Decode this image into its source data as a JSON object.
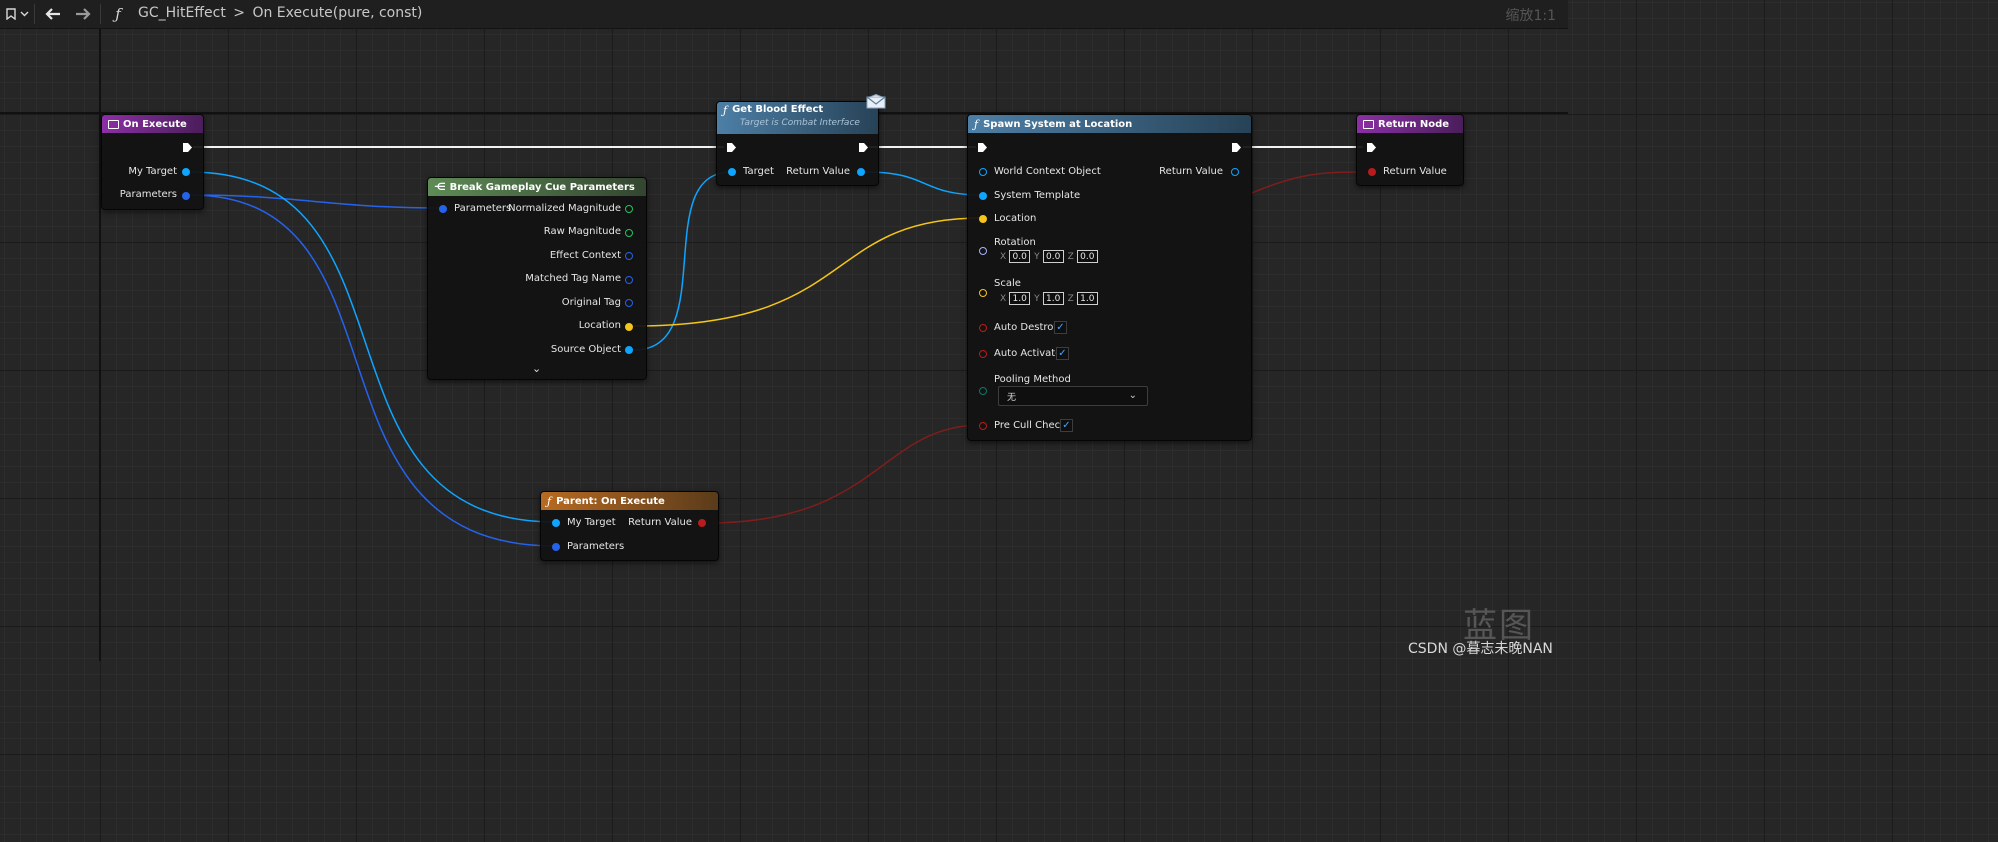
{
  "toolbar": {
    "breadcrumb_graph": "GC_HitEffect",
    "breadcrumb_separator": ">",
    "breadcrumb_function": "On Execute(pure, const)",
    "zoom": "缩放1:1",
    "icons": [
      "bookmark-icon",
      "chevron-down-icon",
      "back-arrow-icon",
      "forward-arrow-icon",
      "function-icon"
    ]
  },
  "colors": {
    "exec": "#ffffff",
    "object": "#0ea5ff",
    "struct": "#2563eb",
    "vector": "#f5c518",
    "rotator": "#a5b4fc",
    "float": "#22c55e",
    "bool": "#b91c1c",
    "enum": "#0f766e",
    "name": "#1d4ed8"
  },
  "nodes": {
    "on_execute": {
      "title": "On Execute",
      "pins": {
        "my_target": "My Target",
        "parameters": "Parameters"
      }
    },
    "break_params": {
      "title": "Break Gameplay Cue Parameters",
      "input": "Parameters",
      "outputs": {
        "normalized_magnitude": "Normalized Magnitude",
        "raw_magnitude": "Raw Magnitude",
        "effect_context": "Effect Context",
        "matched_tag_name": "Matched Tag Name",
        "original_tag": "Original Tag",
        "location": "Location",
        "source_object": "Source Object"
      }
    },
    "get_blood": {
      "title": "Get Blood Effect",
      "subtitle": "Target is Combat Interface",
      "input": "Target",
      "output": "Return Value"
    },
    "spawn": {
      "title": "Spawn System at Location",
      "pins": {
        "world_context": "World Context Object",
        "system_template": "System Template",
        "location": "Location",
        "rotation": "Rotation",
        "scale": "Scale",
        "auto_destroy": "Auto Destroy",
        "auto_activate": "Auto Activate",
        "pooling_method": "Pooling Method",
        "pre_cull": "Pre Cull Check",
        "return_value": "Return Value"
      },
      "axis_labels": {
        "x": "X",
        "y": "Y",
        "z": "Z"
      },
      "rotation": {
        "x": "0.0",
        "y": "0.0",
        "z": "0.0"
      },
      "scale": {
        "x": "1.0",
        "y": "1.0",
        "z": "1.0"
      },
      "auto_destroy_checked": true,
      "auto_activate_checked": true,
      "pre_cull_checked": true,
      "pooling_value": "无"
    },
    "return_node": {
      "title": "Return Node",
      "pin": "Return Value"
    },
    "parent_on_execute": {
      "title": "Parent: On Execute",
      "pins": {
        "my_target": "My Target",
        "parameters": "Parameters",
        "return_value": "Return Value"
      }
    }
  },
  "watermark": {
    "logo_text": "蓝图",
    "credit": "CSDN @暮志未晚NAN"
  }
}
